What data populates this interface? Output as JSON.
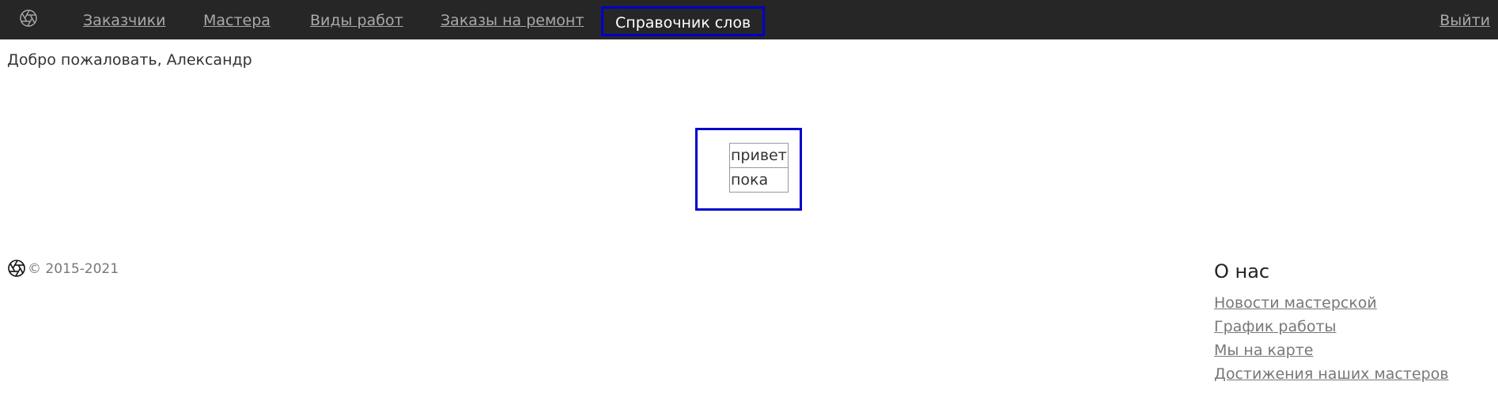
{
  "nav": {
    "logo_icon": "aperture-icon",
    "items": [
      {
        "label": "Заказчики"
      },
      {
        "label": "Мастера"
      },
      {
        "label": "Виды работ"
      },
      {
        "label": "Заказы на ремонт"
      },
      {
        "label": "Справочник слов",
        "active": true
      }
    ],
    "logout_label": "Выйти"
  },
  "greeting": "Добро пожаловать, Александр",
  "words": [
    "привет",
    "пока"
  ],
  "footer": {
    "logo_icon": "aperture-icon",
    "copyright": "© 2015-2021",
    "about": {
      "heading": "О нас",
      "links": [
        "Новости мастерской",
        "График работы",
        "Мы на карте",
        "Достижения наших мастеров"
      ]
    }
  },
  "colors": {
    "navbar_bg": "#262626",
    "nav_link": "#a9a9a9",
    "active_link": "#ffffff",
    "highlight_border": "#0000cc"
  }
}
